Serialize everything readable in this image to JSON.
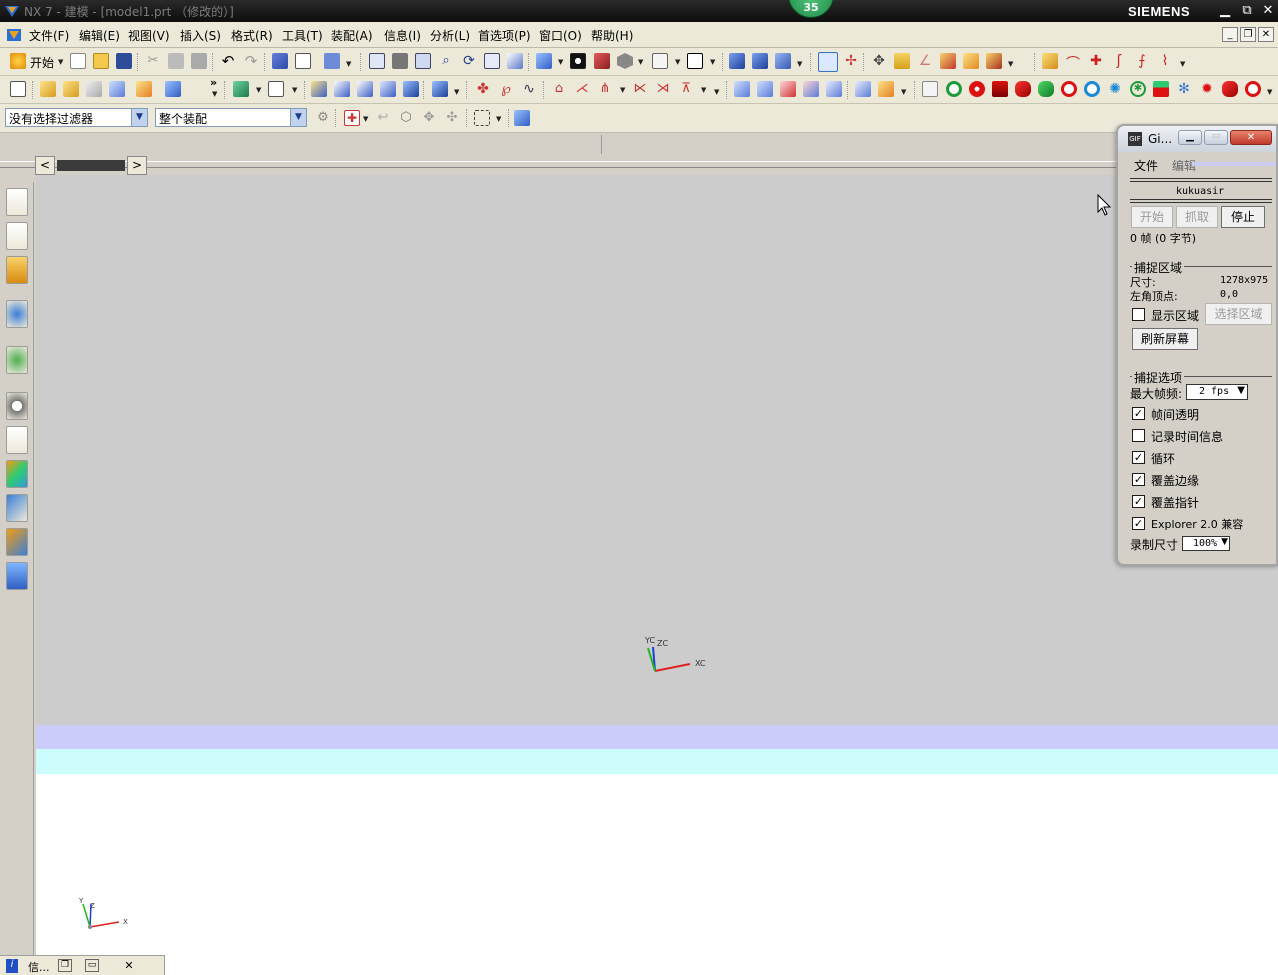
{
  "titlebar": {
    "title": "NX 7 - 建模 - [model1.prt （修改的）]",
    "brand": "SIEMENS",
    "badge": "35"
  },
  "menubar": {
    "items": [
      "文件(F)",
      "编辑(E)",
      "视图(V)",
      "插入(S)",
      "格式(R)",
      "工具(T)",
      "装配(A)",
      "信息(I)",
      "分析(L)",
      "首选项(P)",
      "窗口(O)",
      "帮助(H)"
    ]
  },
  "toolbar1": {
    "start_label": "开始"
  },
  "filterbar": {
    "selection_filter": "没有选择过滤器",
    "assembly_scope": "整个装配"
  },
  "gif_window": {
    "title": "Gi...",
    "menu": [
      "文件",
      "编辑"
    ],
    "author": "kukuasir",
    "buttons": {
      "start": "开始",
      "grab": "抓取",
      "stop": "停止"
    },
    "frame_info": "0 帧  (0 字节)",
    "capture_region": {
      "heading": "捕捉区域",
      "size_label": "尺寸:",
      "size_value": "1278x975",
      "origin_label": "左角顶点:",
      "origin_value": "0,0",
      "show_region_label": "显示区域",
      "select_region_button": "选择区域",
      "refresh_button": "刷新屏幕"
    },
    "capture_options": {
      "heading": "捕捉选项",
      "max_fps_label": "最大帧频:",
      "max_fps_value": "2 fps",
      "checkboxes": [
        {
          "label": "帧间透明",
          "checked": true
        },
        {
          "label": "记录时间信息",
          "checked": false
        },
        {
          "label": "循环",
          "checked": true
        },
        {
          "label": "覆盖边缘",
          "checked": true
        },
        {
          "label": "覆盖指针",
          "checked": true
        },
        {
          "label": "Explorer 2.0 兼容",
          "checked": true
        }
      ],
      "record_size_label": "录制尺寸",
      "record_size_value": "100%"
    }
  },
  "viewport": {
    "wcs_labels": {
      "yc": "YC",
      "zc": "ZC",
      "xc": "XC"
    },
    "abs_labels": {
      "y": "Y",
      "z": "Z",
      "x": "X"
    }
  },
  "bottom_tabs": {
    "info_label": "信..."
  }
}
